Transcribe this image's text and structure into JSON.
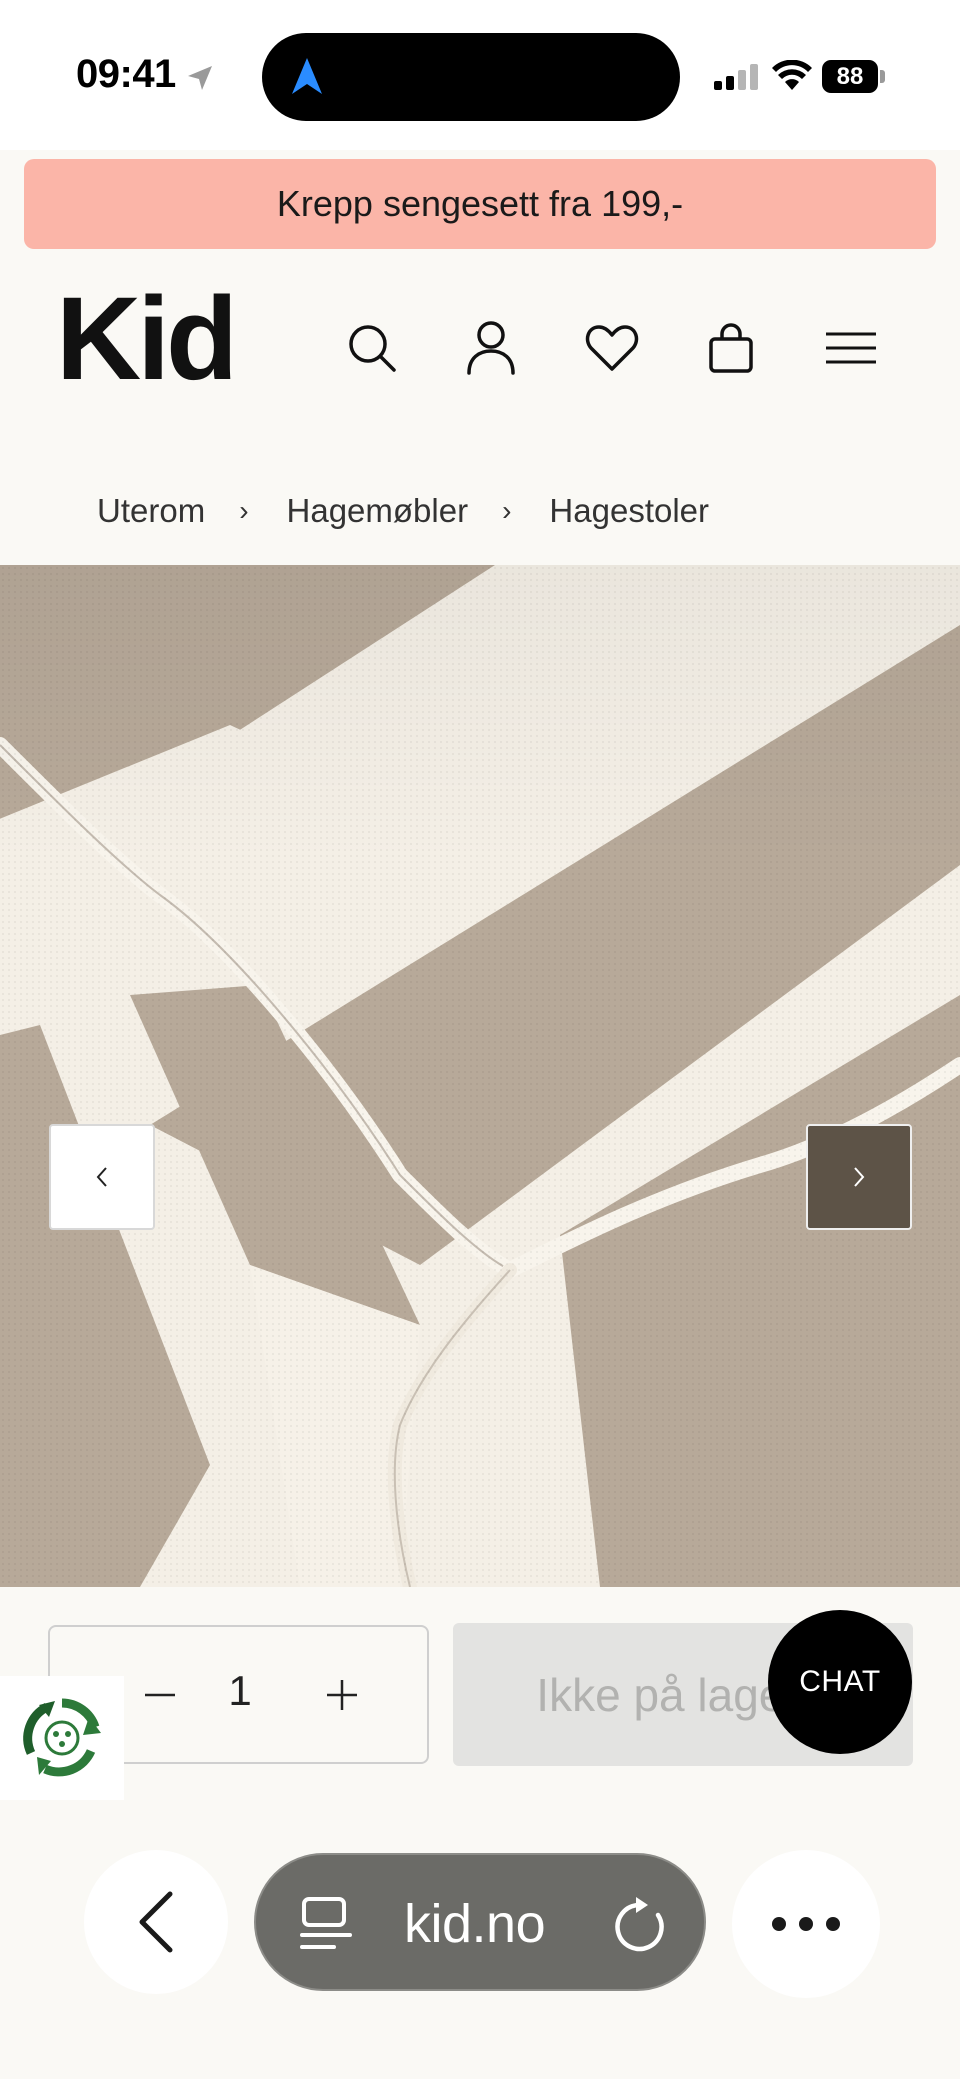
{
  "status_bar": {
    "time": "09:41",
    "battery": "88"
  },
  "promo": {
    "text": "Krepp sengesett fra 199,-"
  },
  "header": {
    "logo": "Kid",
    "icons": [
      "search-icon",
      "account-icon",
      "heart-icon",
      "bag-icon",
      "menu-icon"
    ]
  },
  "breadcrumb": {
    "items": [
      "Uterom",
      "Hagemøbler",
      "Hagestoler"
    ],
    "separator": "›"
  },
  "product": {
    "colors": {
      "stripe_light": "#f4efe6",
      "stripe_dark": "#b7a999"
    }
  },
  "purchase": {
    "quantity": "1",
    "button_label": "Ikke på lager",
    "chat_label": "CHAT"
  },
  "browser": {
    "url": "kid.no"
  },
  "colors": {
    "promo_bg": "#fbb5a8",
    "next_button": "#5d5347",
    "background": "#faf9f5"
  }
}
